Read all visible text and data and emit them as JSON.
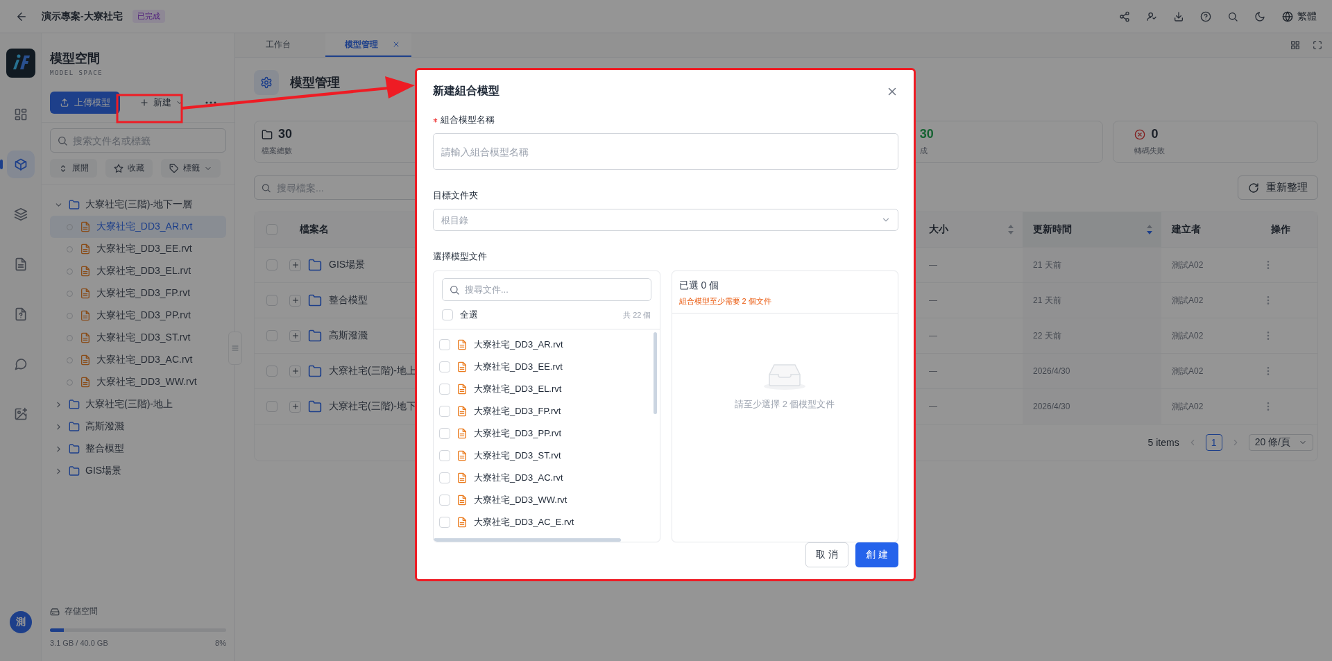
{
  "header": {
    "title": "演示專案-大寮社宅",
    "badge": "已完成",
    "language": "繁體"
  },
  "rail": {
    "items": [
      {
        "kind": "dashboard",
        "selected": false
      },
      {
        "kind": "cube",
        "selected": true
      },
      {
        "kind": "layers",
        "selected": false
      },
      {
        "kind": "document",
        "selected": false
      },
      {
        "kind": "help-file",
        "selected": false
      },
      {
        "kind": "chat",
        "selected": false
      },
      {
        "kind": "image-add",
        "selected": false
      }
    ],
    "avatar": "測"
  },
  "sidebar": {
    "title": "模型空間",
    "subtitle": "MODEL SPACE",
    "upload": "上傳模型",
    "new": "新建",
    "search_placeholder": "搜索文件名或標籤",
    "filters": [
      {
        "kind": "expand",
        "label": "展開"
      },
      {
        "kind": "star",
        "label": "收藏"
      },
      {
        "kind": "tag",
        "label": "標籤",
        "dropdown": true
      }
    ],
    "tree": [
      {
        "label": "大寮社宅(三階)-地下一層",
        "expanded": true,
        "children": [
          {
            "label": "大寮社宅_DD3_AR.rvt",
            "selected": true
          },
          {
            "label": "大寮社宅_DD3_EE.rvt",
            "selected": false
          },
          {
            "label": "大寮社宅_DD3_EL.rvt",
            "selected": false
          },
          {
            "label": "大寮社宅_DD3_FP.rvt",
            "selected": false
          },
          {
            "label": "大寮社宅_DD3_PP.rvt",
            "selected": false
          },
          {
            "label": "大寮社宅_DD3_ST.rvt",
            "selected": false
          },
          {
            "label": "大寮社宅_DD3_AC.rvt",
            "selected": false
          },
          {
            "label": "大寮社宅_DD3_WW.rvt",
            "selected": false
          }
        ]
      },
      {
        "label": "大寮社宅(三階)-地上",
        "expanded": false
      },
      {
        "label": "高斯潑濺",
        "expanded": false
      },
      {
        "label": "整合模型",
        "expanded": false
      },
      {
        "label": "GIS場景",
        "expanded": false
      }
    ],
    "storage": {
      "label": "存儲空間",
      "usage": "3.1 GB / 40.0 GB",
      "percent": "8%",
      "level": 0.08
    }
  },
  "tabs": [
    {
      "label": "工作台",
      "selected": false,
      "closable": false
    },
    {
      "label": "模型管理",
      "selected": true,
      "closable": true
    }
  ],
  "page": {
    "title": "模型管理",
    "stats": [
      {
        "kind": "total",
        "value": "30",
        "label": "檔案總數"
      },
      {
        "kind": "done",
        "value": "30",
        "label": "成"
      },
      {
        "kind": "failed",
        "value": "0",
        "label": "轉碼失敗"
      }
    ],
    "search_placeholder": "搜尋檔案...",
    "refresh": "重新整理"
  },
  "table": {
    "all_checked": false,
    "columns": [
      {
        "label": "檔案名"
      },
      {
        "label": "大小",
        "sortable": true,
        "sorted": false
      },
      {
        "label": "更新時間",
        "sortable": true,
        "sorted": true
      },
      {
        "label": "建立者"
      },
      {
        "label": "操作"
      }
    ],
    "rows": [
      {
        "name": "GIS場景",
        "size": "—",
        "updated": "21 天前",
        "creator": "測試A02",
        "checked": false
      },
      {
        "name": "整合模型",
        "size": "—",
        "updated": "21 天前",
        "creator": "測試A02",
        "checked": false
      },
      {
        "name": "高斯潑濺",
        "size": "—",
        "updated": "22 天前",
        "creator": "測試A02",
        "checked": false
      },
      {
        "name": "大寮社宅(三階)-地上",
        "size": "—",
        "updated": "2026/4/30",
        "creator": "測試A02",
        "checked": false
      },
      {
        "name": "大寮社宅(三階)-地下",
        "size": "—",
        "updated": "2026/4/30",
        "creator": "測試A02",
        "checked": false
      }
    ]
  },
  "pagination": {
    "total": "5 items",
    "pages": [
      {
        "label": "1",
        "selected": true
      }
    ],
    "page_size": "20 條/頁"
  },
  "dialog": {
    "title": "新建組合模型",
    "name_field": {
      "label": "組合模型名稱",
      "required": true,
      "placeholder": "請輸入組合模型名稱"
    },
    "folder_field": {
      "label": "目標文件夾",
      "placeholder": "根目錄"
    },
    "files_label": "選擇模型文件",
    "file_search_placeholder": "搜尋文件...",
    "select_all": {
      "label": "全選",
      "checked": false
    },
    "total": "共 22 個",
    "files": [
      {
        "name": "大寮社宅_DD3_AR.rvt",
        "checked": false
      },
      {
        "name": "大寮社宅_DD3_EE.rvt",
        "checked": false
      },
      {
        "name": "大寮社宅_DD3_EL.rvt",
        "checked": false
      },
      {
        "name": "大寮社宅_DD3_FP.rvt",
        "checked": false
      },
      {
        "name": "大寮社宅_DD3_PP.rvt",
        "checked": false
      },
      {
        "name": "大寮社宅_DD3_ST.rvt",
        "checked": false
      },
      {
        "name": "大寮社宅_DD3_AC.rvt",
        "checked": false
      },
      {
        "name": "大寮社宅_DD3_WW.rvt",
        "checked": false
      },
      {
        "name": "大寮社宅_DD3_AC_E.rvt",
        "checked": false
      }
    ],
    "selected_title": "已選 0 個",
    "selected_hint": "組合模型至少需要 2 個文件",
    "empty_text": "請至少選擇 2 個模型文件",
    "cancel": "取 消",
    "create": "創 建"
  }
}
